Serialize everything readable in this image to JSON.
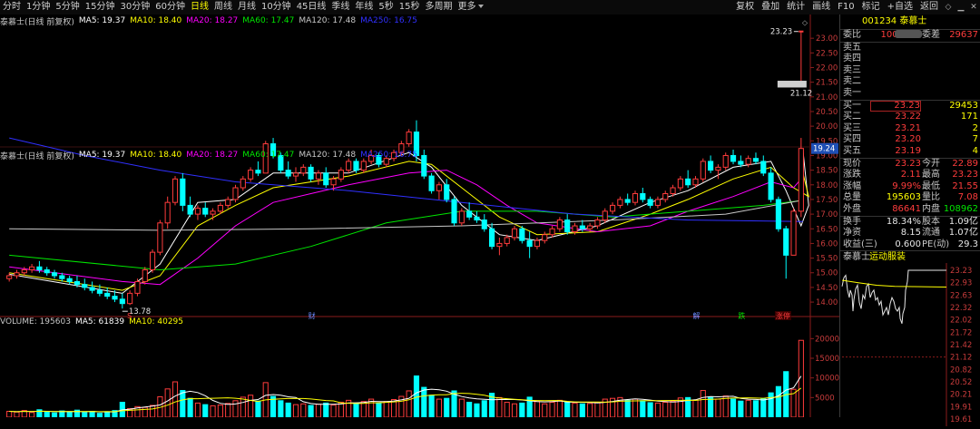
{
  "toolbar": {
    "tabs": [
      "分时",
      "1分钟",
      "5分钟",
      "15分钟",
      "30分钟",
      "60分钟",
      "日线",
      "周线",
      "月线",
      "10分钟",
      "45日线",
      "季线",
      "年线",
      "5秒",
      "15秒",
      "多周期",
      "更多"
    ],
    "active_tab": "日线",
    "right_items": [
      "复权",
      "叠加",
      "统计",
      "画线",
      "F10",
      "标记",
      "+自选",
      "返回"
    ]
  },
  "ma_legend": {
    "title": "泰慕士(日线 前复权)",
    "items": [
      {
        "text": "MA5: 19.37",
        "color": "#ffffff"
      },
      {
        "text": "MA10: 18.40",
        "color": "#ffff00"
      },
      {
        "text": "MA20: 18.27",
        "color": "#ff00ff"
      },
      {
        "text": "MA60: 17.47",
        "color": "#00e600"
      },
      {
        "text": "MA120: 17.48",
        "color": "#c8c8c8"
      },
      {
        "text": "MA250: 16.75",
        "color": "#3030ff"
      }
    ]
  },
  "vol_legend": {
    "items": [
      {
        "text": "VOLUME: 195603",
        "color": "#c8c8c8"
      },
      {
        "text": "MA5: 61839",
        "color": "#ffffff"
      },
      {
        "text": "MA10: 40295",
        "color": "#ffff00"
      }
    ]
  },
  "chart_data": {
    "type": "candlestick",
    "price_axis": {
      "ticks": [
        "23.00",
        "22.50",
        "22.00",
        "21.50",
        "21.00",
        "20.50",
        "20.00",
        "19.50",
        "19.00",
        "18.50",
        "18.00",
        "17.50",
        "17.00",
        "16.50",
        "16.00",
        "15.50",
        "15.00",
        "14.50",
        "14.00"
      ],
      "range": [
        13.6,
        23.5
      ]
    },
    "volume_axis": {
      "ticks": [
        "20000",
        "15000",
        "10000",
        "5000"
      ],
      "range": [
        0,
        21000
      ]
    },
    "annotations": {
      "high_label": "23.23",
      "low_label": "13.78",
      "current_price_tag": "19.24",
      "price_box": "21.12"
    },
    "event_markers": [
      {
        "text": "S",
        "color": "#ff3c3c"
      },
      {
        "text": "财",
        "color": "#6a8cff"
      },
      {
        "text": "解",
        "color": "#6a8cff"
      },
      {
        "text": "跌",
        "color": "#00e600"
      },
      {
        "text": "涨停",
        "color": "#ff3c3c"
      }
    ],
    "ohlc": [
      [
        14.8,
        15.0,
        14.7,
        14.9
      ],
      [
        14.9,
        15.1,
        14.8,
        15.0
      ],
      [
        15.0,
        15.2,
        14.9,
        15.1
      ],
      [
        15.1,
        15.3,
        15.0,
        15.2
      ],
      [
        15.2,
        15.4,
        15.0,
        15.1
      ],
      [
        15.1,
        15.2,
        14.9,
        15.0
      ],
      [
        15.0,
        15.1,
        14.8,
        14.9
      ],
      [
        14.9,
        15.0,
        14.7,
        14.8
      ],
      [
        14.8,
        14.9,
        14.6,
        14.7
      ],
      [
        14.7,
        14.9,
        14.5,
        14.6
      ],
      [
        14.6,
        14.8,
        14.4,
        14.5
      ],
      [
        14.5,
        14.7,
        14.3,
        14.4
      ],
      [
        14.4,
        14.6,
        14.2,
        14.3
      ],
      [
        14.3,
        14.5,
        14.1,
        14.2
      ],
      [
        14.2,
        14.4,
        14.0,
        14.1
      ],
      [
        14.1,
        14.3,
        13.78,
        13.95
      ],
      [
        13.95,
        14.4,
        13.9,
        14.3
      ],
      [
        14.3,
        14.8,
        14.2,
        14.7
      ],
      [
        14.7,
        15.2,
        14.6,
        15.1
      ],
      [
        15.1,
        15.8,
        15.0,
        15.7
      ],
      [
        15.7,
        16.8,
        15.6,
        16.7
      ],
      [
        16.7,
        17.6,
        16.5,
        17.4
      ],
      [
        17.4,
        18.3,
        17.3,
        18.2
      ],
      [
        18.2,
        18.4,
        17.1,
        17.3
      ],
      [
        17.3,
        17.6,
        16.9,
        17.0
      ],
      [
        17.0,
        17.3,
        16.8,
        17.2
      ],
      [
        17.2,
        17.4,
        16.9,
        17.0
      ],
      [
        17.0,
        17.2,
        16.8,
        17.1
      ],
      [
        17.1,
        17.4,
        17.0,
        17.3
      ],
      [
        17.3,
        17.6,
        17.2,
        17.5
      ],
      [
        17.5,
        18.0,
        17.4,
        17.9
      ],
      [
        17.9,
        18.3,
        17.8,
        18.2
      ],
      [
        18.2,
        18.6,
        18.1,
        18.5
      ],
      [
        18.5,
        18.8,
        18.3,
        18.4
      ],
      [
        18.4,
        19.5,
        18.4,
        19.4
      ],
      [
        19.4,
        19.6,
        18.9,
        19.0
      ],
      [
        19.0,
        19.1,
        18.4,
        18.5
      ],
      [
        18.5,
        18.8,
        18.2,
        18.3
      ],
      [
        18.3,
        18.6,
        18.1,
        18.4
      ],
      [
        18.4,
        18.7,
        18.3,
        18.6
      ],
      [
        18.6,
        18.7,
        18.1,
        18.2
      ],
      [
        18.2,
        18.5,
        18.0,
        18.4
      ],
      [
        18.4,
        18.6,
        17.9,
        18.0
      ],
      [
        18.0,
        18.3,
        17.8,
        18.2
      ],
      [
        18.2,
        18.6,
        18.1,
        18.5
      ],
      [
        18.5,
        18.9,
        18.4,
        18.8
      ],
      [
        18.8,
        18.9,
        18.4,
        18.5
      ],
      [
        18.5,
        18.9,
        18.4,
        18.8
      ],
      [
        18.8,
        19.2,
        18.7,
        19.0
      ],
      [
        19.0,
        19.1,
        18.6,
        18.7
      ],
      [
        18.7,
        19.0,
        18.6,
        18.9
      ],
      [
        18.9,
        19.2,
        18.8,
        19.1
      ],
      [
        19.1,
        19.5,
        19.0,
        19.4
      ],
      [
        19.4,
        19.9,
        19.3,
        19.8
      ],
      [
        19.8,
        20.2,
        18.8,
        19.0
      ],
      [
        19.0,
        19.2,
        18.2,
        18.3
      ],
      [
        18.3,
        18.4,
        17.7,
        17.8
      ],
      [
        17.8,
        18.1,
        17.5,
        18.0
      ],
      [
        18.0,
        18.2,
        17.4,
        17.5
      ],
      [
        17.5,
        17.6,
        16.6,
        16.7
      ],
      [
        16.7,
        17.2,
        16.6,
        17.1
      ],
      [
        17.1,
        17.4,
        16.8,
        16.9
      ],
      [
        16.9,
        17.1,
        16.7,
        16.8
      ],
      [
        16.8,
        17.0,
        16.4,
        16.5
      ],
      [
        16.5,
        16.7,
        15.8,
        15.9
      ],
      [
        15.9,
        16.2,
        15.6,
        16.0
      ],
      [
        16.0,
        16.3,
        15.9,
        16.2
      ],
      [
        16.2,
        16.6,
        16.1,
        16.5
      ],
      [
        16.5,
        16.6,
        16.0,
        16.1
      ],
      [
        16.1,
        16.4,
        15.5,
        15.9
      ],
      [
        15.9,
        16.2,
        15.8,
        16.1
      ],
      [
        16.1,
        16.4,
        16.0,
        16.3
      ],
      [
        16.3,
        16.6,
        16.2,
        16.5
      ],
      [
        16.5,
        16.9,
        16.4,
        16.8
      ],
      [
        16.8,
        17.0,
        16.3,
        16.4
      ],
      [
        16.4,
        16.7,
        16.3,
        16.6
      ],
      [
        16.6,
        16.8,
        16.4,
        16.5
      ],
      [
        16.5,
        16.7,
        16.4,
        16.6
      ],
      [
        16.6,
        16.9,
        16.5,
        16.8
      ],
      [
        16.8,
        17.2,
        16.7,
        17.1
      ],
      [
        17.1,
        17.4,
        17.0,
        17.3
      ],
      [
        17.3,
        17.6,
        17.2,
        17.5
      ],
      [
        17.5,
        17.7,
        17.3,
        17.4
      ],
      [
        17.4,
        17.8,
        17.3,
        17.7
      ],
      [
        17.7,
        17.9,
        17.4,
        17.5
      ],
      [
        17.5,
        17.6,
        17.2,
        17.3
      ],
      [
        17.3,
        17.6,
        17.2,
        17.5
      ],
      [
        17.5,
        17.8,
        17.4,
        17.7
      ],
      [
        17.7,
        18.0,
        17.6,
        17.9
      ],
      [
        17.9,
        18.3,
        17.8,
        18.2
      ],
      [
        18.2,
        18.5,
        17.9,
        18.0
      ],
      [
        18.0,
        18.3,
        17.9,
        18.2
      ],
      [
        18.2,
        18.9,
        18.1,
        18.8
      ],
      [
        18.8,
        19.0,
        18.4,
        18.5
      ],
      [
        18.5,
        18.7,
        18.2,
        18.6
      ],
      [
        18.6,
        19.1,
        18.5,
        19.0
      ],
      [
        19.0,
        19.2,
        18.7,
        18.8
      ],
      [
        18.8,
        19.0,
        18.6,
        18.7
      ],
      [
        18.7,
        19.0,
        18.6,
        18.9
      ],
      [
        18.9,
        19.1,
        18.7,
        18.8
      ],
      [
        18.8,
        19.0,
        18.3,
        18.4
      ],
      [
        18.4,
        18.6,
        17.4,
        17.5
      ],
      [
        17.5,
        17.6,
        16.4,
        16.5
      ],
      [
        16.5,
        16.6,
        14.8,
        15.6
      ],
      [
        15.6,
        17.2,
        15.6,
        17.1
      ],
      [
        17.1,
        19.6,
        16.9,
        19.24
      ]
    ],
    "ma": {
      "MA5": [
        [
          0,
          14.95
        ],
        [
          15,
          14.3
        ],
        [
          20,
          15.3
        ],
        [
          25,
          17.4
        ],
        [
          30,
          17.5
        ],
        [
          35,
          18.4
        ],
        [
          45,
          18.4
        ],
        [
          53,
          19.1
        ],
        [
          56,
          18.6
        ],
        [
          60,
          17.3
        ],
        [
          65,
          16.3
        ],
        [
          70,
          16.1
        ],
        [
          78,
          16.6
        ],
        [
          85,
          17.4
        ],
        [
          90,
          17.8
        ],
        [
          96,
          18.6
        ],
        [
          101,
          18.8
        ],
        [
          103,
          17.8
        ],
        [
          104,
          17.2
        ],
        [
          105,
          16.6
        ],
        [
          106,
          17.3
        ],
        [
          107,
          19.2
        ]
      ],
      "MA10": [
        [
          0,
          15.0
        ],
        [
          15,
          14.4
        ],
        [
          20,
          14.9
        ],
        [
          25,
          16.6
        ],
        [
          30,
          17.3
        ],
        [
          35,
          17.9
        ],
        [
          45,
          18.3
        ],
        [
          53,
          18.8
        ],
        [
          56,
          18.7
        ],
        [
          60,
          17.9
        ],
        [
          65,
          16.9
        ],
        [
          70,
          16.3
        ],
        [
          78,
          16.4
        ],
        [
          85,
          17.0
        ],
        [
          90,
          17.5
        ],
        [
          96,
          18.2
        ],
        [
          101,
          18.6
        ],
        [
          104,
          17.9
        ],
        [
          106,
          17.6
        ],
        [
          107,
          18.4
        ]
      ],
      "MA20": [
        [
          0,
          15.2
        ],
        [
          15,
          14.7
        ],
        [
          20,
          14.6
        ],
        [
          25,
          15.5
        ],
        [
          30,
          16.6
        ],
        [
          35,
          17.4
        ],
        [
          45,
          18.0
        ],
        [
          53,
          18.4
        ],
        [
          58,
          18.5
        ],
        [
          62,
          18.0
        ],
        [
          66,
          17.3
        ],
        [
          70,
          16.7
        ],
        [
          78,
          16.4
        ],
        [
          85,
          16.6
        ],
        [
          90,
          17.1
        ],
        [
          96,
          17.6
        ],
        [
          101,
          18.1
        ],
        [
          104,
          17.9
        ],
        [
          107,
          18.27
        ]
      ],
      "MA60": [
        [
          0,
          15.6
        ],
        [
          20,
          15.1
        ],
        [
          30,
          15.3
        ],
        [
          40,
          15.9
        ],
        [
          50,
          16.7
        ],
        [
          60,
          17.1
        ],
        [
          70,
          17.1
        ],
        [
          80,
          16.9
        ],
        [
          90,
          17.1
        ],
        [
          100,
          17.3
        ],
        [
          107,
          17.47
        ]
      ],
      "MA120": [
        [
          0,
          16.5
        ],
        [
          20,
          16.45
        ],
        [
          40,
          16.5
        ],
        [
          60,
          16.6
        ],
        [
          80,
          16.8
        ],
        [
          95,
          17.0
        ],
        [
          107,
          17.48
        ]
      ],
      "MA250": [
        [
          0,
          19.6
        ],
        [
          10,
          19.0
        ],
        [
          20,
          18.5
        ],
        [
          30,
          18.1
        ],
        [
          45,
          17.8
        ],
        [
          60,
          17.4
        ],
        [
          75,
          17.0
        ],
        [
          90,
          16.8
        ],
        [
          107,
          16.75
        ]
      ]
    },
    "volume": [
      1500,
      1300,
      1700,
      1200,
      1900,
      1400,
      1100,
      1600,
      1300,
      1800,
      1200,
      1500,
      1000,
      1400,
      1700,
      3800,
      2200,
      2700,
      2500,
      3000,
      5200,
      7200,
      9000,
      6800,
      4800,
      3600,
      3200,
      2900,
      3100,
      3500,
      4200,
      5100,
      5600,
      4100,
      8800,
      5300,
      4200,
      3600,
      3200,
      3400,
      3000,
      3300,
      3600,
      3100,
      3800,
      4300,
      3500,
      4000,
      4600,
      3600,
      4000,
      4500,
      5300,
      6700,
      10500,
      7600,
      5600,
      4600,
      4800,
      6700,
      4600,
      3800,
      3400,
      4200,
      6100,
      5000,
      3800,
      3400,
      3600,
      5100,
      4000,
      3400,
      3800,
      4300,
      3900,
      3600,
      3400,
      3500,
      3800,
      4600,
      4800,
      5000,
      4300,
      4600,
      4200,
      3700,
      3600,
      3800,
      4100,
      4900,
      5000,
      4400,
      6800,
      5200,
      4600,
      5400,
      4600,
      4100,
      4300,
      4200,
      4700,
      6200,
      7800,
      11600,
      7100,
      19560
    ]
  },
  "right_panel": {
    "title": "001234 泰慕士",
    "weibi": {
      "label": "委比",
      "value": "100.00%",
      "label2": "委差",
      "value2": "29637"
    },
    "sells": [
      {
        "label": "卖五",
        "price": "",
        "vol": ""
      },
      {
        "label": "卖四",
        "price": "",
        "vol": ""
      },
      {
        "label": "卖三",
        "price": "",
        "vol": ""
      },
      {
        "label": "卖二",
        "price": "",
        "vol": ""
      },
      {
        "label": "卖一",
        "price": "",
        "vol": ""
      }
    ],
    "buys": [
      {
        "label": "买一",
        "price": "23.23",
        "vol": "29453"
      },
      {
        "label": "买二",
        "price": "23.22",
        "vol": "171"
      },
      {
        "label": "买三",
        "price": "23.21",
        "vol": "2"
      },
      {
        "label": "买四",
        "price": "23.20",
        "vol": "7"
      },
      {
        "label": "买五",
        "price": "23.19",
        "vol": "4"
      }
    ],
    "stats": [
      {
        "l1": "现价",
        "v1": "23.23",
        "c1": "red",
        "l2": "今开",
        "v2": "22.89",
        "c2": "red"
      },
      {
        "l1": "涨跌",
        "v1": "2.11",
        "c1": "red",
        "l2": "最高",
        "v2": "23.23",
        "c2": "red"
      },
      {
        "l1": "涨幅",
        "v1": "9.99%",
        "c1": "red",
        "l2": "最低",
        "v2": "21.55",
        "c2": "red"
      },
      {
        "l1": "总量",
        "v1": "195603",
        "c1": "yel",
        "l2": "量比",
        "v2": "7.08",
        "c2": "red"
      },
      {
        "l1": "外盘",
        "v1": "86641",
        "c1": "red",
        "l2": "内盘",
        "v2": "108962",
        "c2": "grn"
      }
    ],
    "stats2": [
      {
        "l1": "换手",
        "v1": "18.34%",
        "c1": "wht",
        "l2": "股本",
        "v2": "1.09亿",
        "c2": "wht"
      },
      {
        "l1": "净资",
        "v1": "8.15",
        "c1": "wht",
        "l2": "流通",
        "v2": "1.07亿",
        "c2": "wht"
      },
      {
        "l1": "收益(三)",
        "v1": "0.600",
        "c1": "wht",
        "l2": "PE(动)",
        "v2": "29.3",
        "c2": "wht"
      }
    ],
    "mini": {
      "name": "泰慕士",
      "sector": "运动服装",
      "ticks": [
        "23.23",
        "22.93",
        "22.63",
        "22.32",
        "22.02",
        "21.72",
        "21.42",
        "21.12",
        "20.82",
        "20.52",
        "20.21",
        "19.91",
        "19.61"
      ]
    }
  }
}
